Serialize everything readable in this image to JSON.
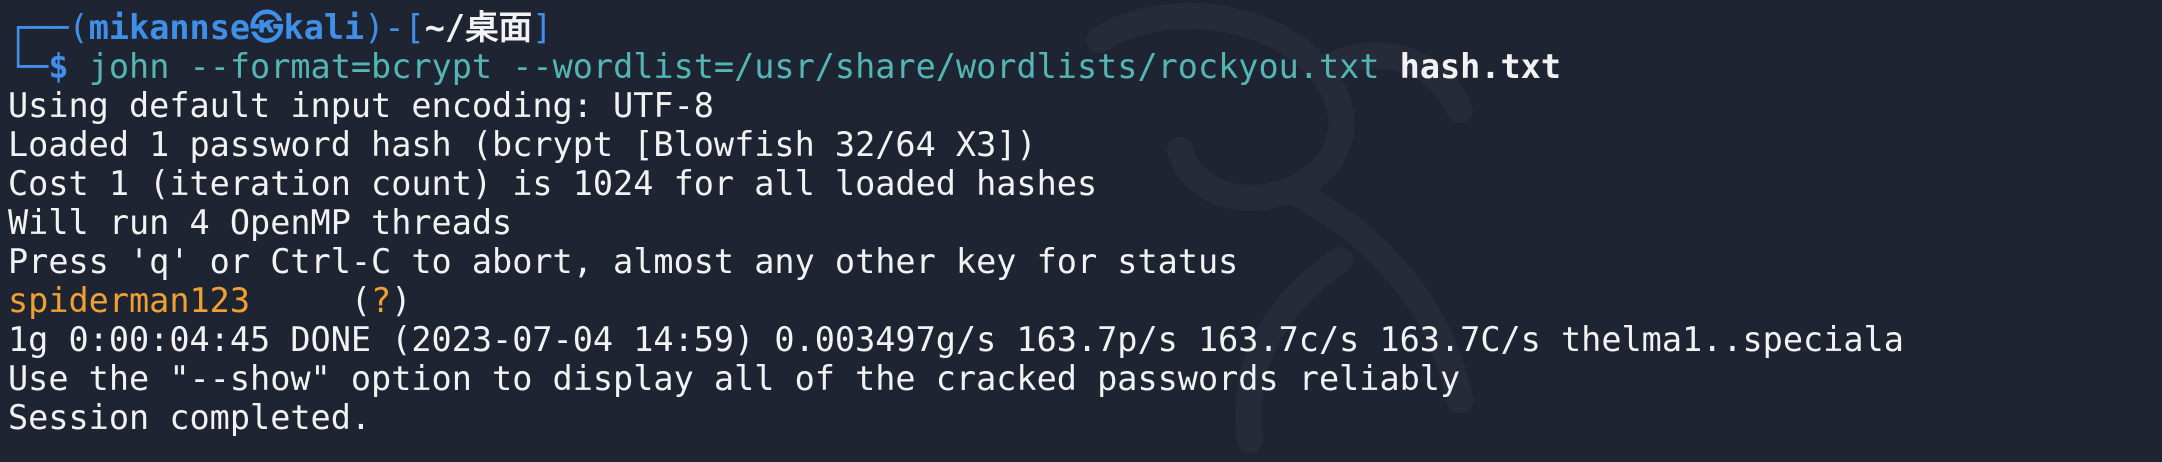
{
  "prompt": {
    "box_top": "┌──(",
    "user": "mikannse",
    "at_symbol": "㉿",
    "host": "kali",
    "bracket_mid": ")-[",
    "path": "~/桌面",
    "bracket_close": "]",
    "box_bottom": "└─",
    "dollar": "$",
    "command": "john --format=bcrypt --wordlist=/usr/share/wordlists/rockyou.txt",
    "argument": "hash.txt"
  },
  "output": {
    "line1": "Using default input encoding: UTF-8",
    "line2": "Loaded 1 password hash (bcrypt [Blowfish 32/64 X3])",
    "line3": "Cost 1 (iteration count) is 1024 for all loaded hashes",
    "line4": "Will run 4 OpenMP threads",
    "line5": "Press 'q' or Ctrl-C to abort, almost any other key for status",
    "cracked_password": "spiderman123",
    "cracked_gap": "     ",
    "cracked_user_open": "(",
    "cracked_user": "?",
    "cracked_user_close": ")",
    "line7": "1g 0:00:04:45 DONE (2023-07-04 14:59) 0.003497g/s 163.7p/s 163.7c/s 163.7C/s thelma1..speciala",
    "line8": "Use the \"--show\" option to display all of the cracked passwords reliably",
    "line9": "Session completed."
  },
  "colors": {
    "background": "#1f2432",
    "prompt_blue": "#3f8fe8",
    "command_cyan": "#53b6b5",
    "password_orange": "#f0a030",
    "text": "#f2f2f2"
  },
  "icons": {
    "watermark": "kali-dragon-icon"
  }
}
